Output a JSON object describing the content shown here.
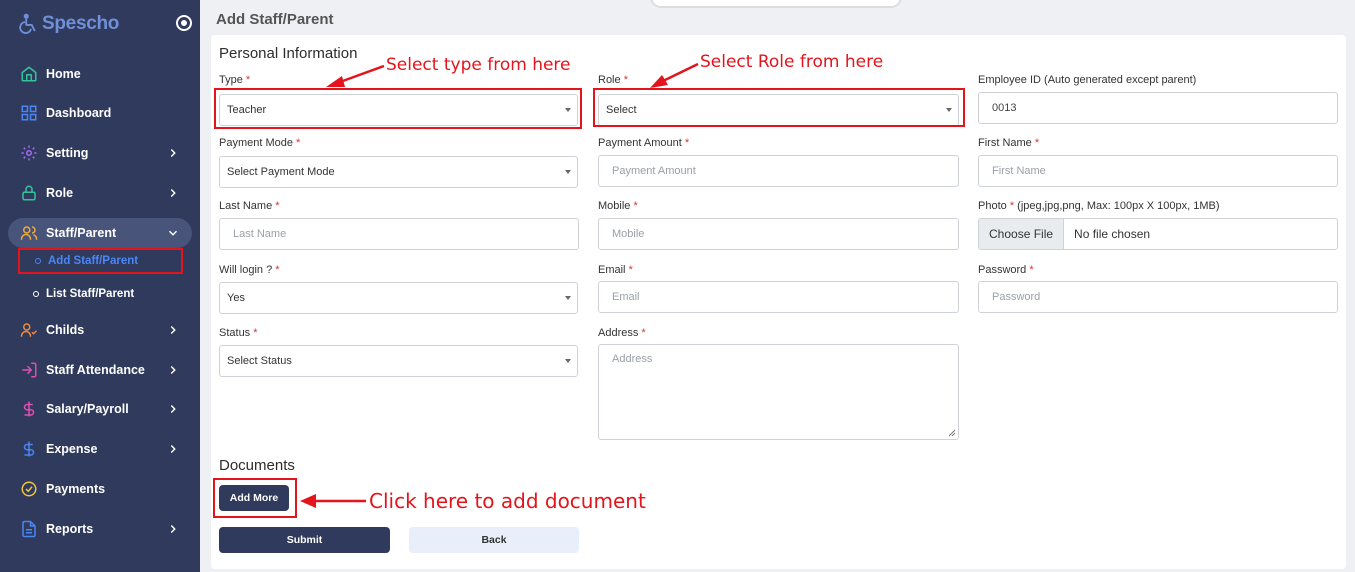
{
  "app": {
    "logo_text": "Spescho"
  },
  "sidebar": {
    "items": [
      {
        "label": "Home",
        "icon": "home-icon"
      },
      {
        "label": "Dashboard",
        "icon": "grid-icon"
      },
      {
        "label": "Setting",
        "icon": "gear-icon"
      },
      {
        "label": "Role",
        "icon": "lock-icon"
      },
      {
        "label": "Staff/Parent",
        "icon": "users-icon"
      },
      {
        "label": "Childs",
        "icon": "user-check-icon"
      },
      {
        "label": "Staff Attendance",
        "icon": "log-in-icon"
      },
      {
        "label": "Salary/Payroll",
        "icon": "dollar-icon"
      },
      {
        "label": "Expense",
        "icon": "dollar-icon"
      },
      {
        "label": "Payments",
        "icon": "check-circle-icon"
      },
      {
        "label": "Reports",
        "icon": "file-icon"
      }
    ],
    "sub_items": [
      {
        "label": "Add Staff/Parent"
      },
      {
        "label": "List Staff/Parent"
      }
    ]
  },
  "page": {
    "title": "Add Staff/Parent"
  },
  "form": {
    "section_personal": "Personal Information",
    "section_documents": "Documents",
    "type": {
      "label": "Type",
      "value": "Teacher"
    },
    "role": {
      "label": "Role",
      "value": "Select"
    },
    "employee_id": {
      "label": "Employee ID (Auto generated except parent)",
      "value": "0013"
    },
    "payment_mode": {
      "label": "Payment Mode",
      "value": "Select Payment Mode"
    },
    "payment_amount": {
      "label": "Payment Amount",
      "placeholder": "Payment Amount"
    },
    "first_name": {
      "label": "First Name",
      "placeholder": "First Name"
    },
    "last_name": {
      "label": "Last Name",
      "placeholder": "Last Name"
    },
    "mobile": {
      "label": "Mobile",
      "placeholder": "Mobile"
    },
    "photo": {
      "label_before": "Photo ",
      "label_after": " (jpeg,jpg,png, Max: 100px X 100px, 1MB)",
      "button": "Choose File",
      "status": "No file chosen"
    },
    "will_login": {
      "label": "Will login ?",
      "value": "Yes"
    },
    "email": {
      "label": "Email",
      "placeholder": "Email"
    },
    "password": {
      "label": "Password",
      "placeholder": "Password"
    },
    "status": {
      "label": "Status",
      "value": "Select Status"
    },
    "address": {
      "label": "Address",
      "placeholder": "Address"
    },
    "required_mark": "*",
    "add_more": "Add More",
    "submit": "Submit",
    "back": "Back"
  },
  "annotations": {
    "type_hint": "Select type from here",
    "role_hint": "Select Role from here",
    "document_hint": "Click here to add document"
  },
  "colors": {
    "sidebar_bg": "#2f3a5c",
    "accent_blue": "#4b86f5",
    "annotation_red": "#e3141c",
    "required_red": "#d8343a"
  }
}
